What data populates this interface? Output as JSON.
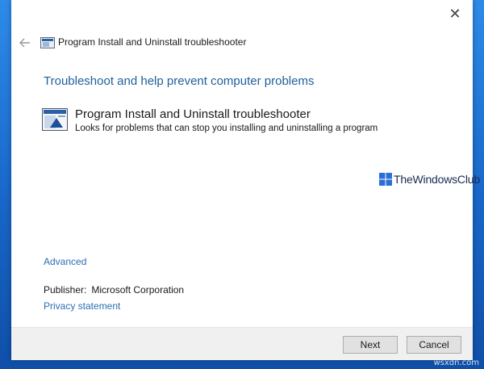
{
  "window": {
    "close_glyph": "✕",
    "title": "Program Install and Uninstall troubleshooter"
  },
  "main": {
    "heading": "Troubleshoot and help prevent computer problems",
    "item": {
      "title": "Program Install and Uninstall troubleshooter",
      "description": "Looks for problems that can stop you installing and uninstalling a program"
    },
    "advanced_link": "Advanced",
    "publisher_label": "Publisher:",
    "publisher_value": "Microsoft Corporation",
    "privacy_link": "Privacy statement"
  },
  "watermark": {
    "text": "TheWindowsClub"
  },
  "footer": {
    "next_label": "Next",
    "cancel_label": "Cancel"
  },
  "corner_watermark": "wsxdn.com",
  "icons": [
    "close-icon",
    "back-arrow-icon",
    "troubleshooter-icon",
    "windows-logo-icon"
  ],
  "colors": {
    "link": "#2a6fb4",
    "heading": "#1f5f9c",
    "desktop": "#1866c8"
  }
}
